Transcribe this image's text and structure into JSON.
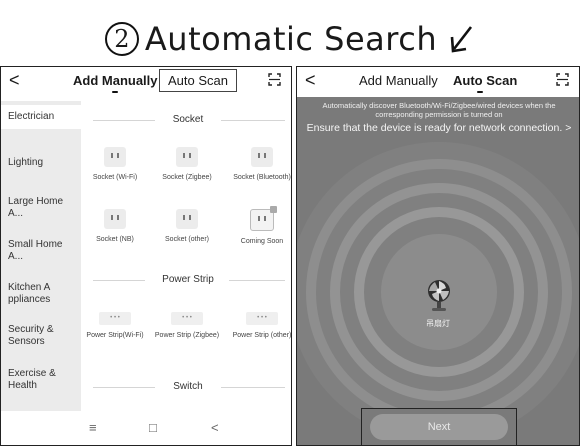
{
  "title": {
    "step_number": "2",
    "text": "Automatic Search"
  },
  "left": {
    "tabs": {
      "add_manually": "Add Manually",
      "auto_scan": "Auto Scan"
    },
    "sidebar": [
      "Electrician",
      "Lighting",
      "Large Home A...",
      "Small Home A...",
      "Kitchen A ppliances",
      "Security & Sensors",
      "Exercise & Health"
    ],
    "sections": {
      "socket": "Socket",
      "power_strip": "Power Strip",
      "switch": "Switch"
    },
    "socket_devices": [
      "Socket (Wi-Fi)",
      "Socket (Zigbee)",
      "Socket (Bluetooth)",
      "Socket (NB)",
      "Socket (other)",
      "Coming Soon"
    ],
    "power_strip_devices": [
      "Power Strip(Wi-Fi)",
      "Power Strip (Zigbee)",
      "Power Strip (other)"
    ],
    "nav": {
      "menu": "≡",
      "home": "□",
      "back": "<"
    }
  },
  "right": {
    "tabs": {
      "add_manually": "Add Manually",
      "auto_scan": "Auto Scan"
    },
    "note_small": "Automatically discover Bluetooth/Wi-Fi/Zigbee/wired devices when the corresponding permission is turned on",
    "note_main": "Ensure that the device is ready for network connection. >",
    "device_name": "吊扇灯",
    "next": "Next"
  }
}
